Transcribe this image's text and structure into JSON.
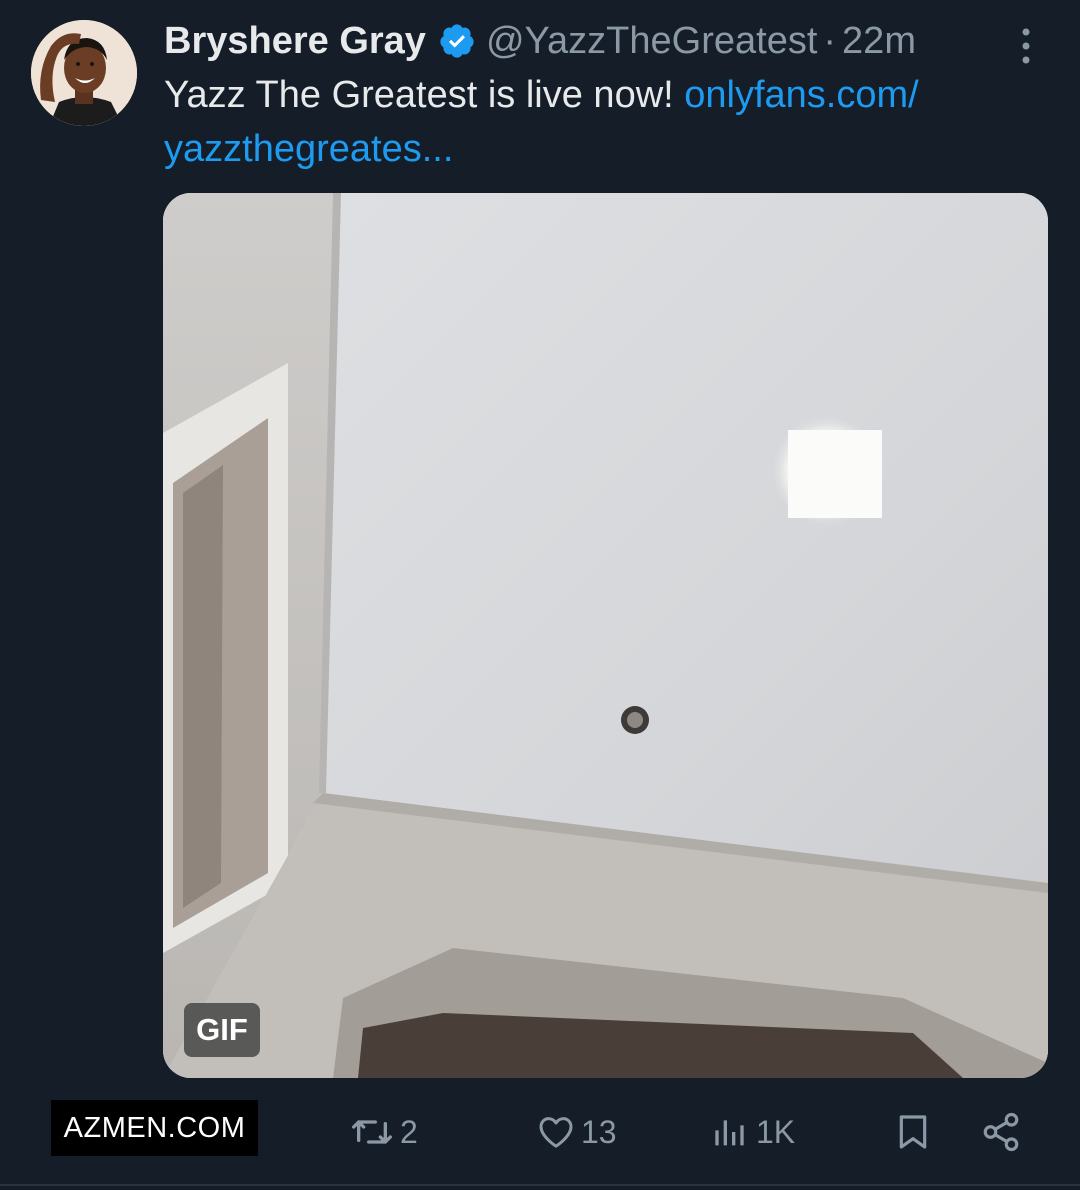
{
  "tweet": {
    "author_name": "Bryshere Gray",
    "author_handle": "@YazzTheGreatest",
    "separator": "·",
    "time": "22m",
    "text": "Yazz The Greatest is live now!",
    "link_line1": "onlyfans.com/",
    "link_line2": "yazzthegreates..."
  },
  "media": {
    "badge": "GIF"
  },
  "actions": {
    "retweets": "2",
    "likes": "13",
    "views": "1K"
  },
  "watermark": {
    "text": "AZMEN.COM"
  },
  "colors": {
    "background": "#151d28",
    "link": "#1d9bf0",
    "muted": "#8b98a5",
    "verified": "#1d9bf0"
  },
  "icons": [
    "verified-badge-icon",
    "more-options-icon",
    "reply-icon",
    "retweet-icon",
    "like-heart-icon",
    "views-chart-icon",
    "bookmark-icon",
    "share-icon"
  ]
}
